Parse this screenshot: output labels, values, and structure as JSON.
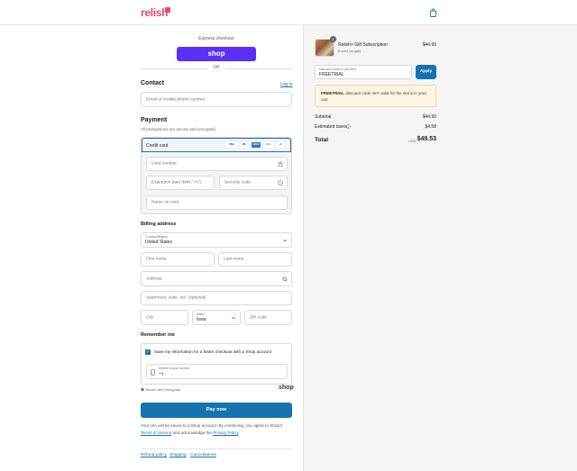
{
  "brand": {
    "logo": "relish",
    "accent": "#e8486a"
  },
  "express": {
    "label": "Express checkout",
    "shop_button": "shop",
    "or": "OR"
  },
  "contact": {
    "heading": "Contact",
    "login_link": "Log in",
    "email_placeholder": "Email or mobile phone number"
  },
  "payment": {
    "heading": "Payment",
    "subtitle": "All transactions are secure and encrypted.",
    "method": "Credit card",
    "brands": [
      "VISA",
      "MC",
      "AMEX",
      "DISC",
      "+4"
    ],
    "card_number": "Card number",
    "expiration": "Expiration date (MM / YY)",
    "security": "Security code",
    "name_on_card": "Name on card"
  },
  "billing": {
    "heading": "Billing address",
    "country_label": "Country/Region",
    "country_value": "United States",
    "first_name": "First name",
    "last_name": "Last name",
    "address": "Address",
    "apartment": "Apartment, suite, etc. (optional)",
    "city": "City",
    "state_label": "State",
    "state_value": "Iowa",
    "zip": "ZIP code"
  },
  "remember": {
    "heading": "Remember me",
    "checkbox_label": "Save my information for a faster checkout with a Shop account",
    "phone_label": "Mobile phone number",
    "phone_value": "+1",
    "secure_note": "Secure and encrypted",
    "shop_word": "shop"
  },
  "pay": {
    "button": "Pay now",
    "legal_1": "Your info will be saved to a Shop account. By continuing, you agree to Shop's",
    "terms": "Terms of Service",
    "legal_2": "and acknowledge the",
    "privacy": "Privacy Policy",
    "legal_end": "."
  },
  "footer": {
    "links": [
      "Refund policy",
      "Shipping",
      "Cancellations"
    ]
  },
  "order": {
    "item_name": "Relish+ Gift Subscription",
    "item_variant": "6 card (single)",
    "item_price": "$44.95",
    "item_qty": "1",
    "discount_label": "Discount code or gift card",
    "discount_value": "FREETRIAL",
    "apply": "Apply",
    "warning_code": "FREETRIAL",
    "warning_text": "discount code isn't valid for the items in your cart",
    "subtotal_label": "Subtotal",
    "subtotal_value": "$44.95",
    "taxes_label": "Estimated taxes",
    "taxes_value": "$4.58",
    "total_label": "Total",
    "currency": "USD",
    "total_value": "$49.53"
  }
}
